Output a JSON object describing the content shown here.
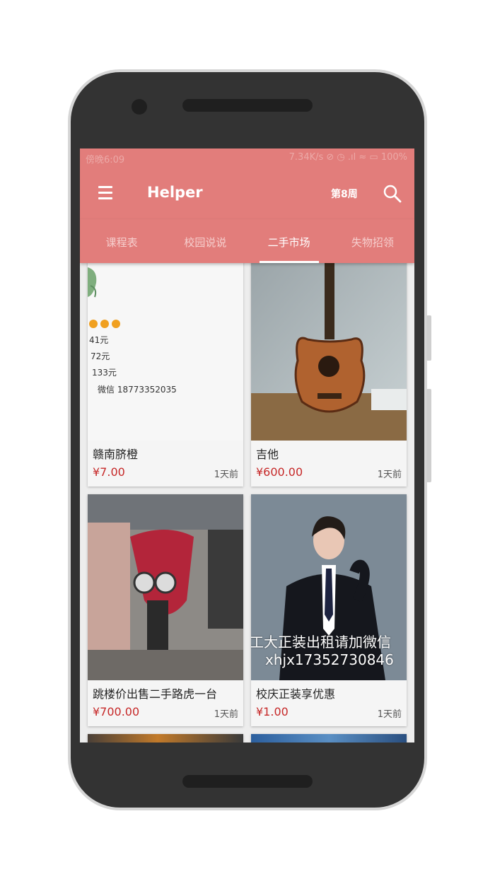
{
  "statusbar": {
    "time": "傍晚6:09",
    "right": "7.34K/s ⊘ ◷ .ıl ≈ ▭ 100%"
  },
  "toolbar": {
    "title": "Helper",
    "week": "第8周",
    "menu_icon": "menu-icon",
    "search_icon": "search-icon"
  },
  "tabs": [
    {
      "label": "课程表",
      "active": false
    },
    {
      "label": "校园说说",
      "active": false
    },
    {
      "label": "二手市场",
      "active": true
    },
    {
      "label": "失物招领",
      "active": false
    }
  ],
  "colors": {
    "primary": "#e27d7b",
    "price": "#c62828"
  },
  "items": [
    {
      "title": "赣南脐橙",
      "price": "¥7.00",
      "time": "1天前",
      "image_text": [
        "41元",
        "72元",
        "133元",
        "微信  18773352035"
      ]
    },
    {
      "title": "吉他",
      "price": "¥600.00",
      "time": "1天前"
    },
    {
      "title": "跳楼价出售二手路虎一台",
      "price": "¥700.00",
      "time": "1天前"
    },
    {
      "title": "校庆正装享优惠",
      "price": "¥1.00",
      "time": "1天前",
      "image_text": [
        "工大正装出租请加微信",
        "xhjx17352730846"
      ]
    }
  ]
}
